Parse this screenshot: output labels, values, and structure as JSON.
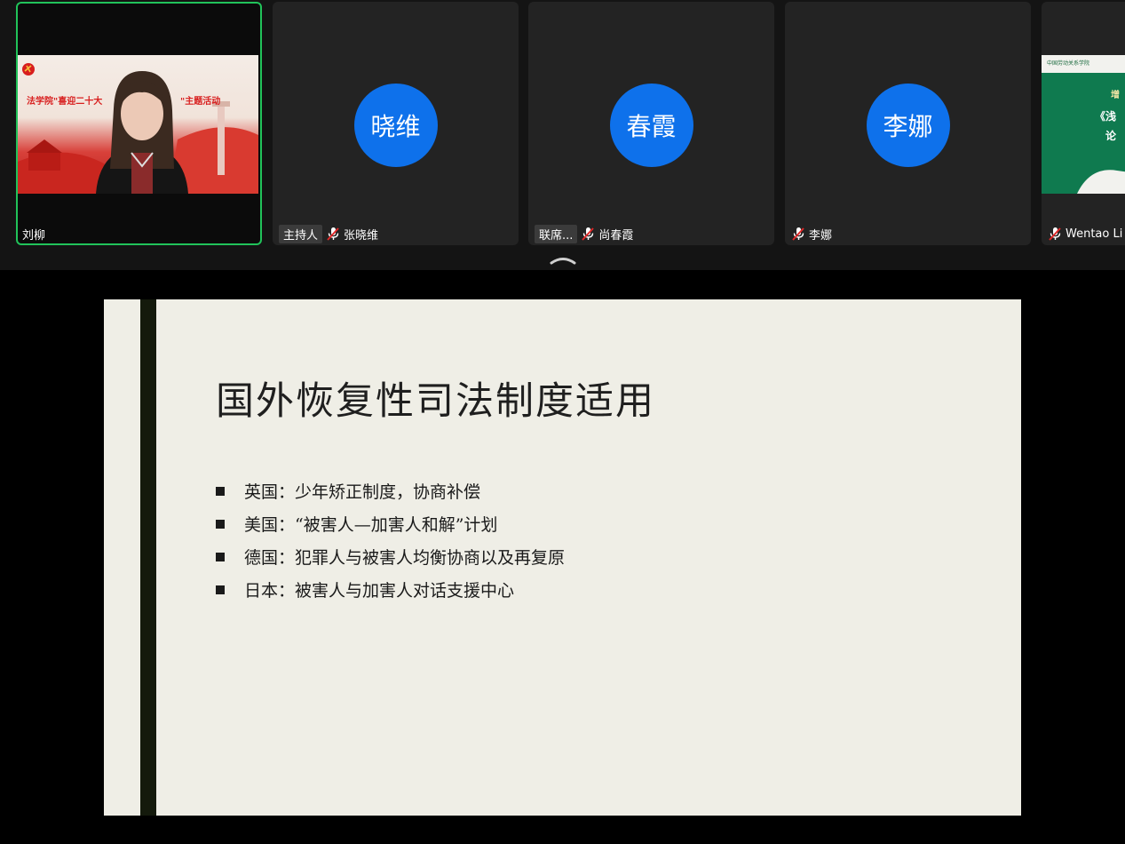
{
  "participants": [
    {
      "display_name": "刘柳",
      "role": "",
      "avatar_text": "",
      "has_video": true,
      "video_banner_left": "法学院\"喜迎二十大",
      "video_banner_right": "\"主题活动"
    },
    {
      "display_name": "张晓维",
      "role": "主持人",
      "avatar_text": "晓维"
    },
    {
      "display_name": "尚春霞",
      "role": "联席...",
      "avatar_text": "春霞"
    },
    {
      "display_name": "李娜",
      "role": "",
      "avatar_text": "李娜"
    },
    {
      "display_name": "Wentao Li",
      "role": "",
      "avatar_text": "",
      "has_video": true,
      "video_text_1": "中国劳动关系学院",
      "video_text_2": "增",
      "video_text_3": "《浅",
      "video_text_4": "论"
    }
  ],
  "icons": {
    "mic": "mic-muted-icon",
    "collapse": "chevron-up-icon"
  },
  "colors": {
    "avatar_bg": "#0e71eb",
    "active_speaker_border": "#21c35a",
    "mic_muted": "#e02828"
  },
  "slide": {
    "title": "国外恢复性司法制度适用",
    "bullets": [
      "英国：少年矫正制度，协商补偿",
      "美国：“被害人—加害人和解”计划",
      "德国：犯罪人与被害人均衡协商以及再复原",
      "日本：被害人与加害人对话支援中心"
    ]
  }
}
